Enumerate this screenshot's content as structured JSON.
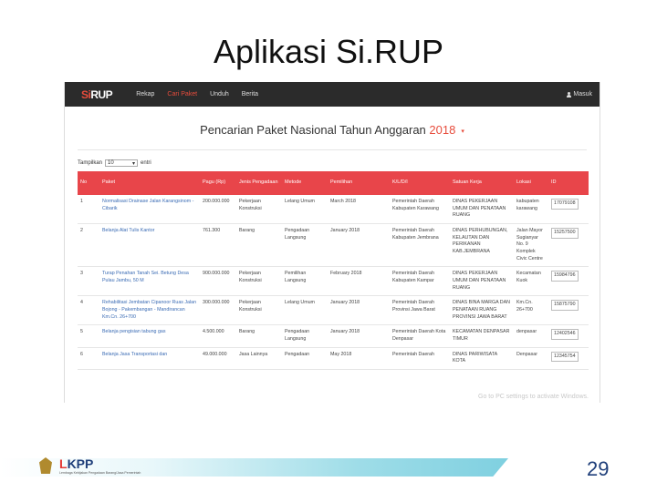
{
  "slide": {
    "title": "Aplikasi Si.RUP",
    "page_number": "29"
  },
  "app": {
    "logo_prefix": "Si",
    "logo_main": "RUP",
    "nav": [
      {
        "label": "Rekap",
        "active": false
      },
      {
        "label": "Cari Paket",
        "active": true
      },
      {
        "label": "Unduh",
        "active": false
      },
      {
        "label": "Berita",
        "active": false
      }
    ],
    "login_label": "Masuk"
  },
  "heading": {
    "text": "Pencarian Paket Nasional Tahun Anggaran",
    "year": "2018"
  },
  "controls": {
    "show_label": "Tampilkan",
    "page_size": "10",
    "suffix": "entri"
  },
  "table": {
    "columns": [
      "No",
      "Paket",
      "Pagu (Rp)",
      "Jenis Pengadaan",
      "Metode",
      "Pemilihan",
      "K/L/D/I",
      "Satuan Kerja",
      "Lokasi",
      "ID"
    ],
    "rows": [
      [
        "1",
        "Normalisasi Drainase Jalan Karangsinom - Cibarik",
        "200.000.000",
        "Pekerjaan Konstruksi",
        "Lelang Umum",
        "March 2018",
        "Pemerintah Daerah Kabupaten Karawang",
        "DINAS PEKERJAAN UMUM DAN PENATAAN RUANG",
        "kabupaten karawang",
        "17079108"
      ],
      [
        "2",
        "Belanja Alat Tulis Kantor",
        "761.300",
        "Barang",
        "Pengadaan Langsung",
        "January 2018",
        "Pemerintah Daerah Kabupaten Jembrana",
        "DINAS PERHUBUNGAN, KELAUTAN DAN PERIKANAN KAB.JEMBRANA",
        "Jalan Mayor Sugianyar No. 9 Komplek Civic Centre",
        "15257500"
      ],
      [
        "3",
        "Turap Penahan Tanah Sei. Betung Desa Pulau Jambu, 50 M",
        "900.000.000",
        "Pekerjaan Konstruksi",
        "Pemilihan Langsung",
        "February 2018",
        "Pemerintah Daerah Kabupaten Kampar",
        "DINAS PEKERJAAN UMUM DAN PENATAAN RUANG",
        "Kecamatan Kuok",
        "15984796"
      ],
      [
        "4",
        "Rehabilitasi Jembatan Cipanoor Ruas Jalan Bojong - Pakembangan - Mandirancan Km.Cn. 26+700",
        "300.000.000",
        "Pekerjaan Konstruksi",
        "Lelang Umum",
        "January 2018",
        "Pemerintah Daerah Provinsi Jawa Barat",
        "DINAS BINA MARGA DAN PENATAAN RUANG PROVINSI JAWA BARAT",
        "Km.Cn. 26+700",
        "15875790"
      ],
      [
        "5",
        "Belanja pengisian tabung gas",
        "4.500.000",
        "Barang",
        "Pengadaan Langsung",
        "January 2018",
        "Pemerintah Daerah Kota Denpasar",
        "KECAMATAN DENPASAR TIMUR",
        "denpasar",
        "12402546"
      ],
      [
        "6",
        "Belanja Jasa Transportasi dan",
        "49.000.000",
        "Jasa Lainnya",
        "Pengadaan",
        "May 2018",
        "Pemerintah Daerah",
        "DINAS PARIWISATA KOTA",
        "Denpasar",
        "12345754"
      ]
    ]
  },
  "watermark": "Go to PC settings to activate Windows.",
  "footer": {
    "logo_text_l": "L",
    "logo_text_rest": "KPP",
    "logo_sub": "Lembaga Kebijakan Pengadaan Barang/Jasa Pemerintah"
  },
  "colors": {
    "accent": "#e8454a",
    "navbar": "#2b2b2b",
    "link": "#3a6bb4"
  }
}
